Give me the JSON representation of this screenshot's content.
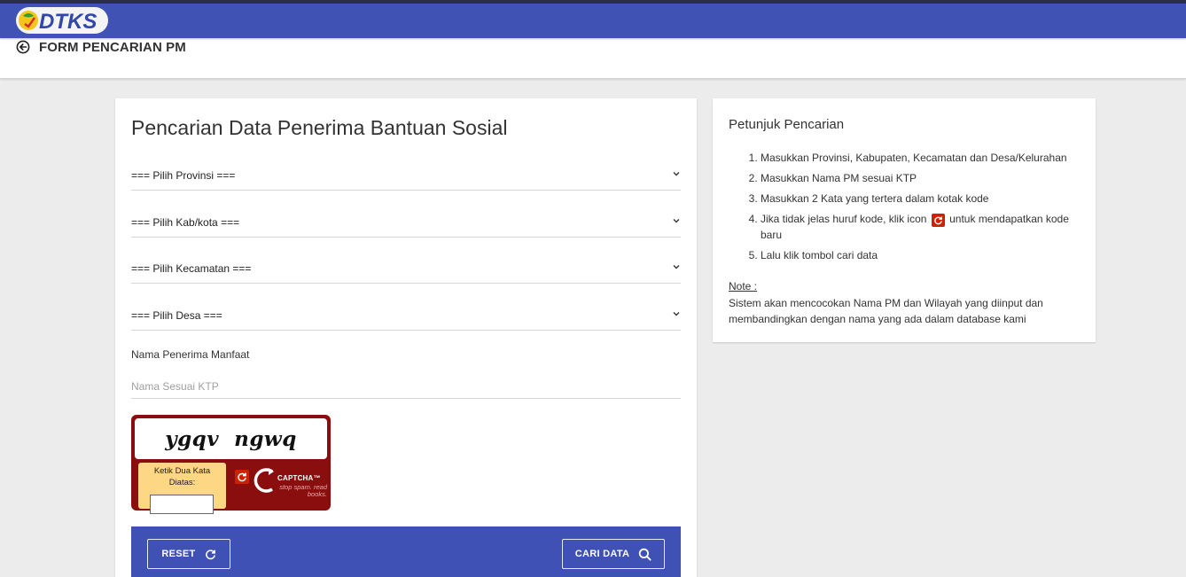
{
  "app": {
    "logo_text": "DTKS"
  },
  "header": {
    "title": "FORM PENCARIAN PM"
  },
  "form": {
    "title": "Pencarian Data Penerima Bantuan Sosial",
    "selects": {
      "provinsi": "=== Pilih Provinsi ===",
      "kabkota": "=== Pilih Kab/kota ===",
      "kecamatan": "=== Pilih Kecamatan ===",
      "desa": "=== Pilih Desa ==="
    },
    "name_label": "Nama Penerima Manfaat",
    "name_placeholder": "Nama Sesuai KTP",
    "name_value": ""
  },
  "captcha": {
    "words": "ygqv  ngwq",
    "prompt": "Ketik Dua Kata Diatas:",
    "input_value": "",
    "brand": "CAPTCHA™",
    "slogan": "stop spam. read books."
  },
  "actions": {
    "reset_label": "RESET",
    "search_label": "CARI DATA"
  },
  "help": {
    "title": "Petunjuk Pencarian",
    "steps": {
      "s1": "Masukkan Provinsi, Kabupaten, Kecamatan dan Desa/Kelurahan",
      "s2": "Masukkan Nama PM sesuai KTP",
      "s3": "Masukkan 2 Kata yang tertera dalam kotak kode",
      "s4_before": "Jika tidak jelas huruf kode, klik icon",
      "s4_after": "untuk mendapatkan kode baru",
      "s5": "Lalu klik tombol cari data"
    },
    "note_label": "Note :",
    "note_text": "Sistem akan mencocokan Nama PM dan Wilayah yang diinput dan membandingkan dengan nama yang ada dalam database kami"
  },
  "colors": {
    "topbar": "#4152b5",
    "action_bar": "#3f51b5",
    "captcha_bg": "#8b0e0e",
    "captcha_prompt_bg": "#fdd783",
    "reload_icon": "#cc2200"
  },
  "icons": {
    "back": "arrow-left-circle-icon",
    "chevron": "chevron-down-icon",
    "reload": "refresh-icon",
    "search": "search-icon"
  }
}
